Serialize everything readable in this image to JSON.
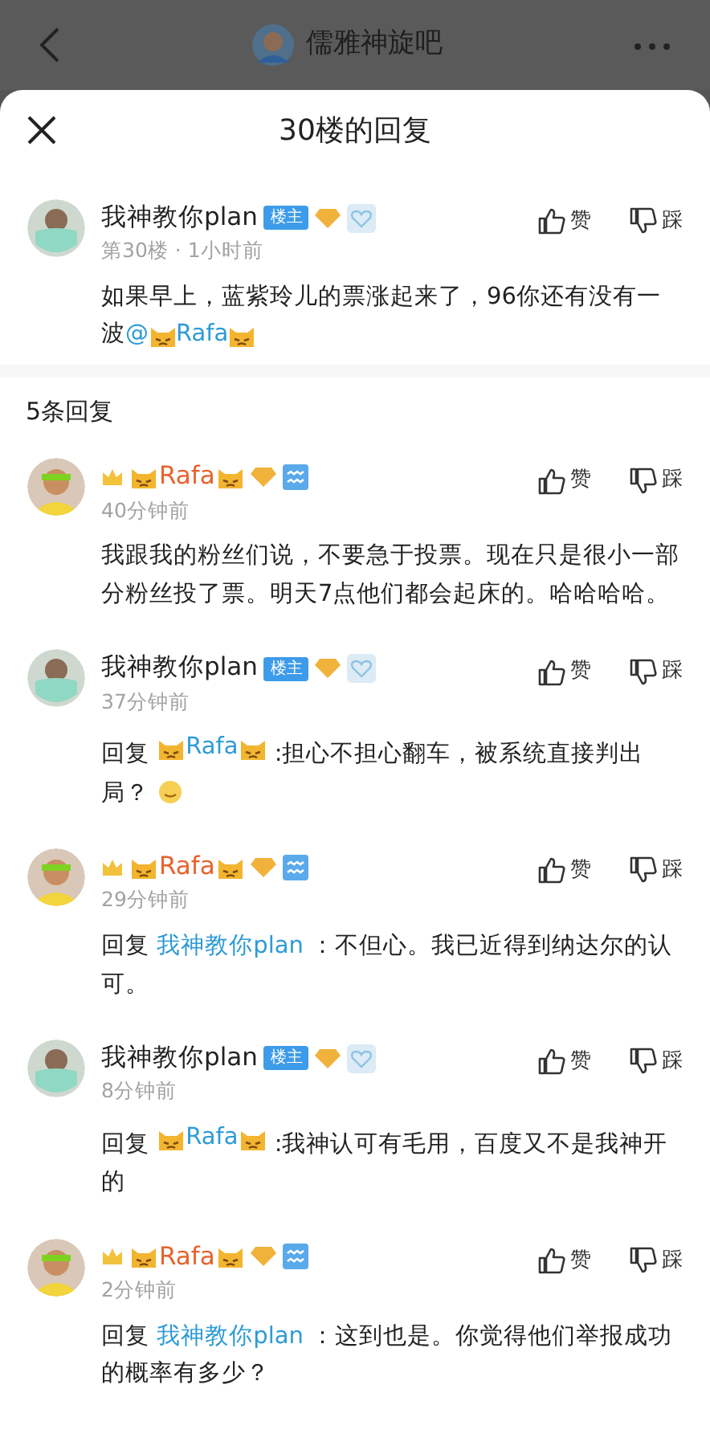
{
  "top_bar": {
    "title": "儒雅神旋吧"
  },
  "sheet": {
    "title": "30楼的回复"
  },
  "post": {
    "author": {
      "kind": "op",
      "name": "我神教你plan",
      "badge": "楼主"
    },
    "meta": "第30楼 · 1小时前",
    "text": "如果早上，蓝紫玲儿的票涨起来了，96你还有没有一波",
    "mention": {
      "prefix": "@",
      "name": "Rafa",
      "kind": "cat-name"
    },
    "like": "赞",
    "dislike": "踩"
  },
  "reply_count": "5条回复",
  "replies": [
    {
      "author": {
        "kind": "crowned",
        "name": "Rafa"
      },
      "meta": "40分钟前",
      "text": "我跟我的粉丝们说，不要急于投票。现在只是很小一部分粉丝投了票。明天7点他们都会起床的。哈哈哈哈。",
      "like": "赞",
      "dislike": "踩"
    },
    {
      "author": {
        "kind": "op",
        "name": "我神教你plan",
        "badge": "楼主"
      },
      "meta": "37分钟前",
      "reply_word": "回复",
      "reply_to": {
        "name": "Rafa",
        "kind": "cat-name"
      },
      "text": " :担心不担心翻车，被系统直接判出局？",
      "trailing_emoji": true,
      "like": "赞",
      "dislike": "踩"
    },
    {
      "author": {
        "kind": "crowned",
        "name": "Rafa"
      },
      "meta": "29分钟前",
      "reply_word": "回复",
      "reply_to": {
        "name": "我神教你plan",
        "kind": "plain"
      },
      "text": " ：不但心。我已近得到纳达尔的认可。",
      "like": "赞",
      "dislike": "踩"
    },
    {
      "author": {
        "kind": "op",
        "name": "我神教你plan",
        "badge": "楼主"
      },
      "meta": "8分钟前",
      "reply_word": "回复",
      "reply_to": {
        "name": "Rafa",
        "kind": "cat-name"
      },
      "text": " :我神认可有毛用，百度又不是我神开的",
      "like": "赞",
      "dislike": "踩"
    },
    {
      "author": {
        "kind": "crowned",
        "name": "Rafa"
      },
      "meta": "2分钟前",
      "reply_word": "回复",
      "reply_to": {
        "name": "我神教你plan",
        "kind": "plain"
      },
      "text": " ：这到也是。你觉得他们举报成功的概率有多少？",
      "like": "赞",
      "dislike": "踩"
    }
  ]
}
